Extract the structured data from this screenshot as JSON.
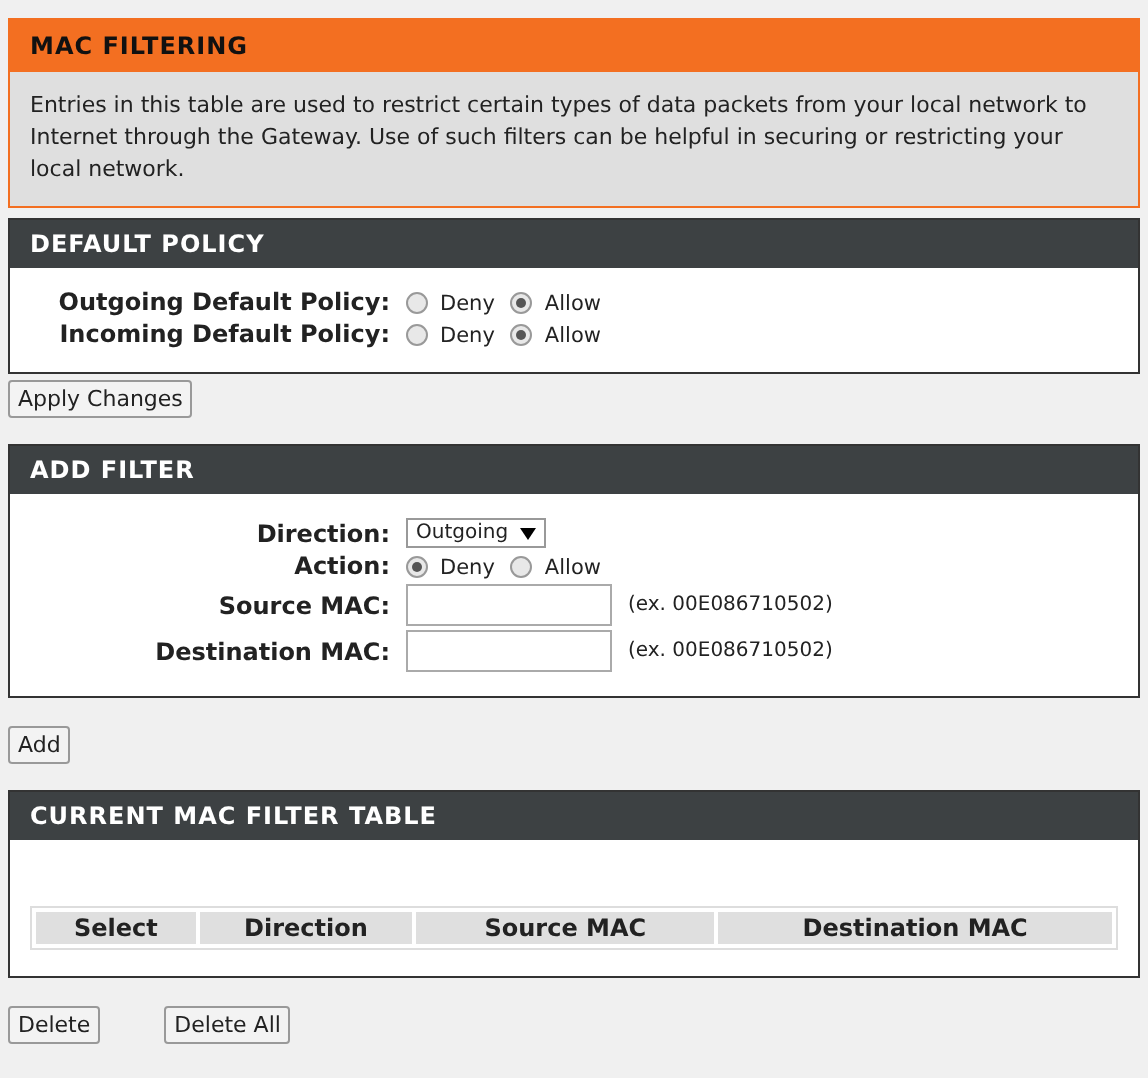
{
  "header": {
    "title": "MAC FILTERING",
    "description": "Entries in this table are used to restrict certain types of data packets from your local network to Internet through the Gateway. Use of such filters can be helpful in securing or restricting your local network."
  },
  "default_policy": {
    "title": "DEFAULT POLICY",
    "rows": [
      {
        "label": "Outgoing Default Policy:",
        "options": [
          {
            "label": "Deny",
            "selected": false
          },
          {
            "label": "Allow",
            "selected": true
          }
        ]
      },
      {
        "label": "Incoming Default Policy:",
        "options": [
          {
            "label": "Deny",
            "selected": false
          },
          {
            "label": "Allow",
            "selected": true
          }
        ]
      }
    ]
  },
  "apply_button": "Apply Changes",
  "add_filter": {
    "title": "ADD FILTER",
    "direction": {
      "label": "Direction:",
      "value": "Outgoing"
    },
    "action": {
      "label": "Action:",
      "options": [
        {
          "label": "Deny",
          "selected": true
        },
        {
          "label": "Allow",
          "selected": false
        }
      ]
    },
    "fields": [
      {
        "label": "Source MAC:",
        "hint": "(ex. 00E086710502)"
      },
      {
        "label": "Destination MAC:",
        "hint": "(ex. 00E086710502)"
      }
    ]
  },
  "add_button": "Add",
  "table": {
    "title": "CURRENT MAC FILTER TABLE",
    "columns": [
      "Select",
      "Direction",
      "Source MAC",
      "Destination MAC"
    ]
  },
  "buttons": [
    "Delete",
    "Delete All"
  ]
}
